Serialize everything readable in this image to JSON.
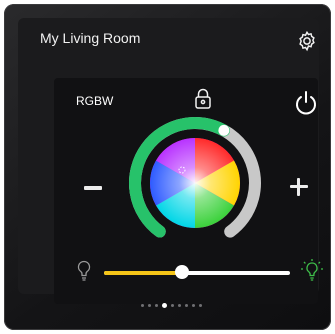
{
  "header": {
    "title": "My Living Room",
    "settings_icon": "gear-icon"
  },
  "light": {
    "mode_label": "RGBW",
    "lock_icon": "padlock-icon",
    "power_icon": "power-icon",
    "decrease_icon": "minus-icon",
    "increase_icon": "plus-icon",
    "ring_level": 0.6,
    "brightness": 0.42,
    "white_icon_off": "bulb-outline-icon",
    "white_icon_on": "bulb-on-icon"
  },
  "pagination": {
    "count": 9,
    "active_index": 3
  },
  "colors": {
    "ring_active": "#27c26a",
    "ring_inactive": "#c8c8c8",
    "slider_fill": "#f5c518",
    "slider_track": "#ffffff",
    "bulb_on": "#3fbf4a",
    "text": "#ffffff"
  }
}
